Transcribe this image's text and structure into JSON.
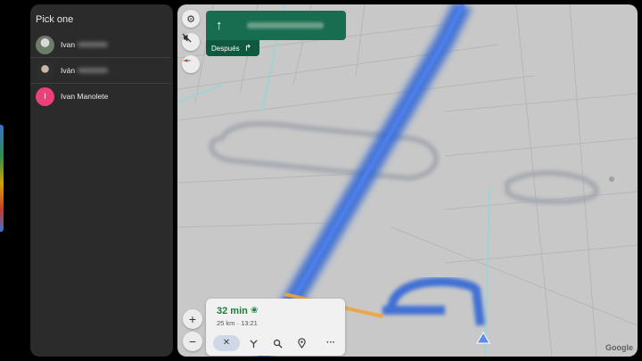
{
  "picker": {
    "title": "Pick one",
    "contacts": [
      {
        "name": "Ivan"
      },
      {
        "name": "Iván"
      },
      {
        "name": "Ivan Manolete",
        "initial": "I"
      }
    ]
  },
  "navigation": {
    "then_label": "Después"
  },
  "trip": {
    "duration": "32 min",
    "details": "25 km · 13:21"
  },
  "map": {
    "zoom_in": "+",
    "zoom_out": "−",
    "logo": "Google"
  },
  "icons": {
    "settings": "gear-icon",
    "mute": "sound-off-icon",
    "compass": "compass-icon",
    "straight": "arrow-up-icon",
    "then_turn": "turn-right-icon",
    "eco": "eco-leaf-icon",
    "close": "close-icon",
    "routes": "alt-routes-icon",
    "search": "search-icon",
    "add_stop": "pin-icon",
    "more": "more-icon"
  },
  "colors": {
    "route": "#3367d6",
    "nav_banner": "#176d4f",
    "eta": "#188038",
    "avatar_letter": "#ec407a"
  }
}
